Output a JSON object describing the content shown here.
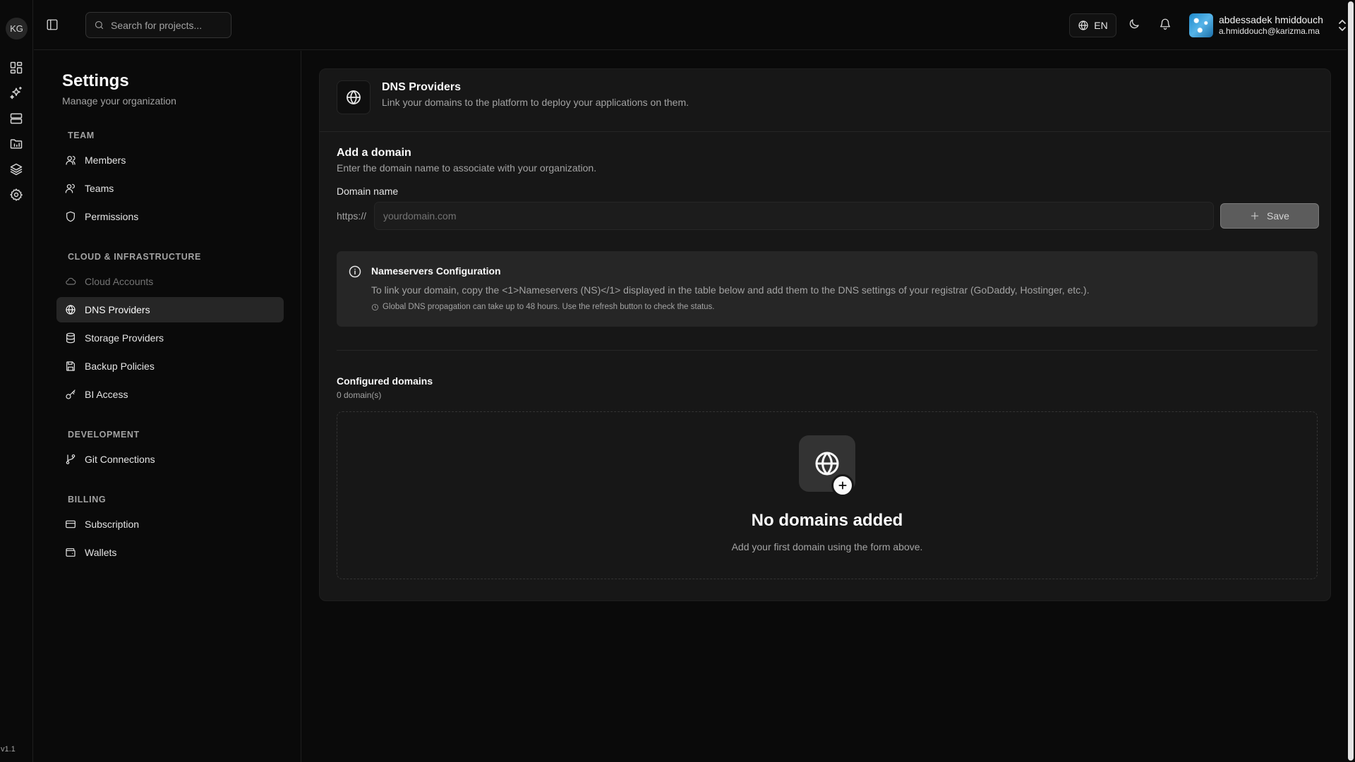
{
  "rail": {
    "org_initials": "KG",
    "icons": [
      "dashboard-icon",
      "sparkles-icon",
      "server-icon",
      "folder-icon",
      "layers-icon",
      "settings-icon"
    ],
    "version": "v1.1"
  },
  "topbar": {
    "search_placeholder": "Search for projects...",
    "language": "EN",
    "user": {
      "name": "abdessadek hmiddouch",
      "email": "a.hmiddouch@karizma.ma"
    }
  },
  "settings_nav": {
    "title": "Settings",
    "subtitle": "Manage your organization",
    "sections": [
      {
        "label": "TEAM",
        "items": [
          {
            "label": "Members",
            "icon": "user-icon"
          },
          {
            "label": "Teams",
            "icon": "users-icon"
          },
          {
            "label": "Permissions",
            "icon": "shield-icon"
          }
        ]
      },
      {
        "label": "CLOUD & INFRASTRUCTURE",
        "items": [
          {
            "label": "Cloud Accounts",
            "icon": "cloud-icon",
            "disabled": true
          },
          {
            "label": "DNS Providers",
            "icon": "globe-icon",
            "active": true
          },
          {
            "label": "Storage Providers",
            "icon": "database-icon"
          },
          {
            "label": "Backup Policies",
            "icon": "save-icon"
          },
          {
            "label": "BI Access",
            "icon": "key-icon"
          }
        ]
      },
      {
        "label": "DEVELOPMENT",
        "items": [
          {
            "label": "Git Connections",
            "icon": "git-branch-icon"
          }
        ]
      },
      {
        "label": "BILLING",
        "items": [
          {
            "label": "Subscription",
            "icon": "credit-card-icon"
          },
          {
            "label": "Wallets",
            "icon": "wallet-icon"
          }
        ]
      }
    ]
  },
  "main": {
    "header": {
      "title": "DNS Providers",
      "subtitle": "Link your domains to the platform to deploy your applications on them."
    },
    "add_domain": {
      "title": "Add a domain",
      "subtitle": "Enter the domain name to associate with your organization.",
      "field_label": "Domain name",
      "prefix": "https://",
      "placeholder": "yourdomain.com",
      "value": "",
      "save_label": "Save"
    },
    "info": {
      "title": "Nameservers Configuration",
      "text": "To link your domain, copy the <1>Nameservers (NS)</1> displayed in the table below and add them to the DNS settings of your registrar (GoDaddy, Hostinger, etc.).",
      "note": "Global DNS propagation can take up to 48 hours. Use the refresh button to check the status."
    },
    "configured": {
      "title": "Configured domains",
      "count": "0 domain(s)",
      "empty_title": "No domains added",
      "empty_subtitle": "Add your first domain using the form above."
    }
  },
  "colors": {
    "background": "#0a0a0a",
    "card": "#171717",
    "active_nav": "#262626",
    "save_button": "#5c5c5c"
  }
}
